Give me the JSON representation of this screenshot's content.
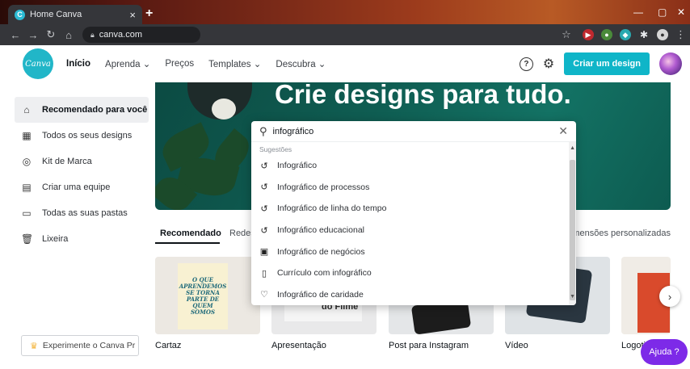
{
  "browser": {
    "tab_title": "Home  Canva",
    "tab_close": "×",
    "new_tab": "+",
    "url": "canva.com",
    "win_minimize": "—",
    "win_maximize": "▢",
    "win_close": "✕"
  },
  "header": {
    "logo_text": "Canva",
    "nav": {
      "inicio": "Início",
      "aprenda": "Aprenda ⌄",
      "precos": "Preços",
      "templates": "Templates ⌄",
      "descubra": "Descubra ⌄"
    },
    "help_icon": "?",
    "create_label": "Criar um design"
  },
  "sidebar": {
    "items": [
      {
        "label": "Recomendado para você",
        "icon": "home-icon",
        "active": true
      },
      {
        "label": "Todos os seus designs",
        "icon": "grid-icon"
      },
      {
        "label": "Kit de Marca",
        "icon": "brand-icon"
      },
      {
        "label": "Criar uma equipe",
        "icon": "team-icon"
      },
      {
        "label": "Todas as suas pastas",
        "icon": "folder-icon"
      },
      {
        "label": "Lixeira",
        "icon": "trash-icon"
      }
    ],
    "try_pro": "Experimente o Canva Pr"
  },
  "hero": {
    "title": "Crie designs para tudo."
  },
  "tabs": {
    "recomendado": "Recomendado",
    "redes": "Redes",
    "dimensoes": "Dimensões personalizadas"
  },
  "cards": [
    {
      "label": "Cartaz",
      "poster_text": [
        "O QUE",
        "APRENDEMOS",
        "SE TORNA",
        "PARTE DE",
        "QUEM SOMOS"
      ]
    },
    {
      "label": "Apresentação",
      "inner_text": "do Filme"
    },
    {
      "label": "Post para Instagram"
    },
    {
      "label": "Vídeo"
    },
    {
      "label": "Logoti"
    }
  ],
  "search": {
    "query": "infográfico",
    "section_label": "Sugestões",
    "suggestions": [
      {
        "label": "Infográfico",
        "icon": "history-icon"
      },
      {
        "label": "Infográfico de processos",
        "icon": "history-icon"
      },
      {
        "label": "Infográfico de linha do tempo",
        "icon": "history-icon"
      },
      {
        "label": "Infográfico educacional",
        "icon": "history-icon"
      },
      {
        "label": "Infográfico de negócios",
        "icon": "briefcase-icon"
      },
      {
        "label": "Currículo com infográfico",
        "icon": "document-icon"
      },
      {
        "label": "Infográfico de caridade",
        "icon": "charity-icon"
      }
    ]
  },
  "help_button": "Ajuda  ?",
  "colors": {
    "brand_teal": "#0fb5c8",
    "help_purple": "#7d2ae8",
    "hero_green": "#0f5d52"
  }
}
